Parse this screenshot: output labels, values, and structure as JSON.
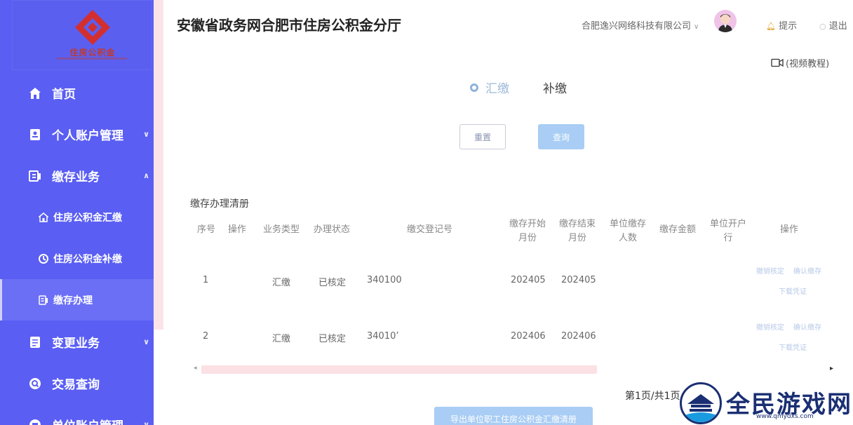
{
  "header": {
    "title": "安徽省政务网合肥市住房公积金分厅",
    "company": "合肥逸兴网络科技有限公司",
    "hint": "提示",
    "logout": "退出",
    "video": "(视频教程)"
  },
  "logo": {
    "text": "住房公积金"
  },
  "sidebar": {
    "items": [
      {
        "label": "首页",
        "icon": "home-icon"
      },
      {
        "label": "个人账户管理",
        "icon": "person-card-icon"
      },
      {
        "label": "缴存业务",
        "icon": "deposit-icon"
      },
      {
        "label": "变更业务",
        "icon": "document-icon"
      },
      {
        "label": "交易查询",
        "icon": "search-icon"
      },
      {
        "label": "单位账户管理",
        "icon": "account-icon"
      }
    ],
    "sub_items": [
      {
        "label": "住房公积金汇缴",
        "icon": "house-icon"
      },
      {
        "label": "住房公积金补缴",
        "icon": "refund-icon"
      },
      {
        "label": "缴存办理",
        "icon": "deposit-icon"
      }
    ]
  },
  "tabs": {
    "selected": "汇缴",
    "other": "补缴"
  },
  "buttons": {
    "reset": "重置",
    "query": "查询",
    "export": "导出单位职工住房公积金汇缴清册"
  },
  "table": {
    "title": "缴存办理清册",
    "headers": {
      "seq": "序号",
      "op": "操作",
      "type": "业务类型",
      "status": "办理状态",
      "reg": "缴交登记号",
      "start1": "缴存开始",
      "start2": "月份",
      "end1": "缴存结束",
      "end2": "月份",
      "count1": "单位缴存",
      "count2": "人数",
      "amount": "缴存金额",
      "bank1": "单位开户",
      "bank2": "行",
      "action": "操作"
    },
    "rows": [
      {
        "seq": "1",
        "type": "汇缴",
        "status": "已核定",
        "reg": "340100",
        "start": "202405",
        "end": "202405",
        "act1": "撤销核定",
        "act2": "确认缴存",
        "act3": "下载凭证"
      },
      {
        "seq": "2",
        "type": "汇缴",
        "status": "已核定",
        "reg": "34010’",
        "start": "202406",
        "end": "202406",
        "act1": "撤销核定",
        "act2": "确认缴存",
        "act3": "下载凭证"
      }
    ]
  },
  "pager": {
    "text": "第1页/共1页"
  },
  "watermark": {
    "text": "全民游戏网",
    "url": "www.qmydxs.com"
  },
  "colors": {
    "sidebar": "#5a5ef3",
    "accent": "#a9cdf4",
    "watermark": "#1a2f73"
  }
}
